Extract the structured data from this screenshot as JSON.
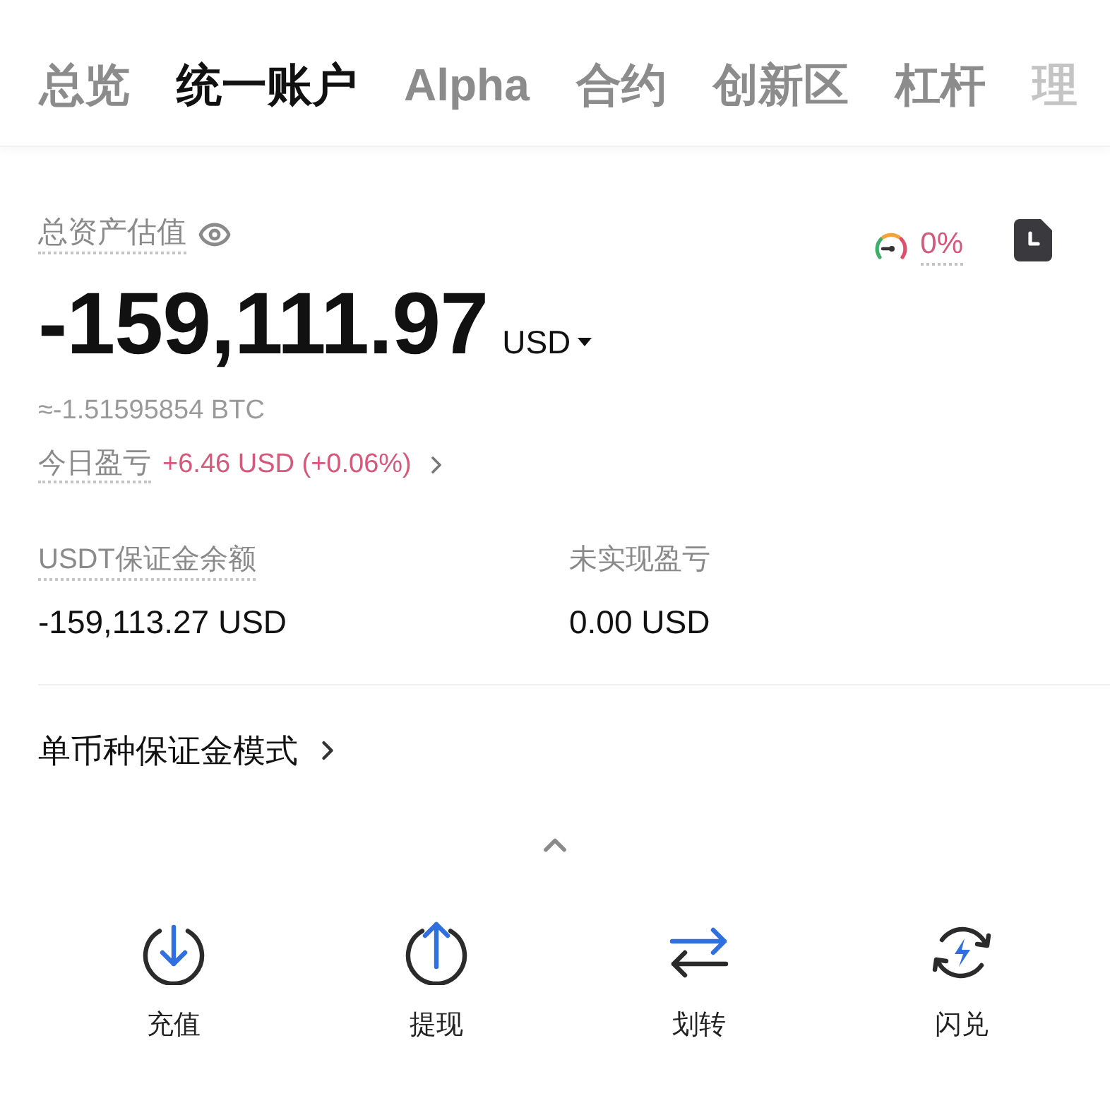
{
  "tabs": [
    {
      "label": "总览",
      "selected": false
    },
    {
      "label": "统一账户",
      "selected": true
    },
    {
      "label": "Alpha",
      "selected": false
    },
    {
      "label": "合约",
      "selected": false
    },
    {
      "label": "创新区",
      "selected": false
    },
    {
      "label": "杠杆",
      "selected": false
    },
    {
      "label": "理",
      "selected": false
    }
  ],
  "summary": {
    "title": "总资产估值",
    "risk_value": "0%",
    "amount": "-159,111.97",
    "currency": "USD",
    "btc_equivalent": "≈-1.51595854 BTC",
    "today_pnl_label": "今日盈亏",
    "today_pnl_value": "+6.46 USD (+0.06%)"
  },
  "stats": [
    {
      "label": "USDT保证金余额",
      "value": "-159,113.27 USD",
      "dotted_underline": true
    },
    {
      "label": "未实现盈亏",
      "value": "0.00 USD",
      "dotted_underline": false
    }
  ],
  "margin_mode": {
    "label": "单币种保证金模式"
  },
  "actions": [
    {
      "kind": "deposit",
      "label": "充值"
    },
    {
      "kind": "withdraw",
      "label": "提现"
    },
    {
      "kind": "transfer",
      "label": "划转"
    },
    {
      "kind": "convert",
      "label": "闪兑"
    }
  ]
}
